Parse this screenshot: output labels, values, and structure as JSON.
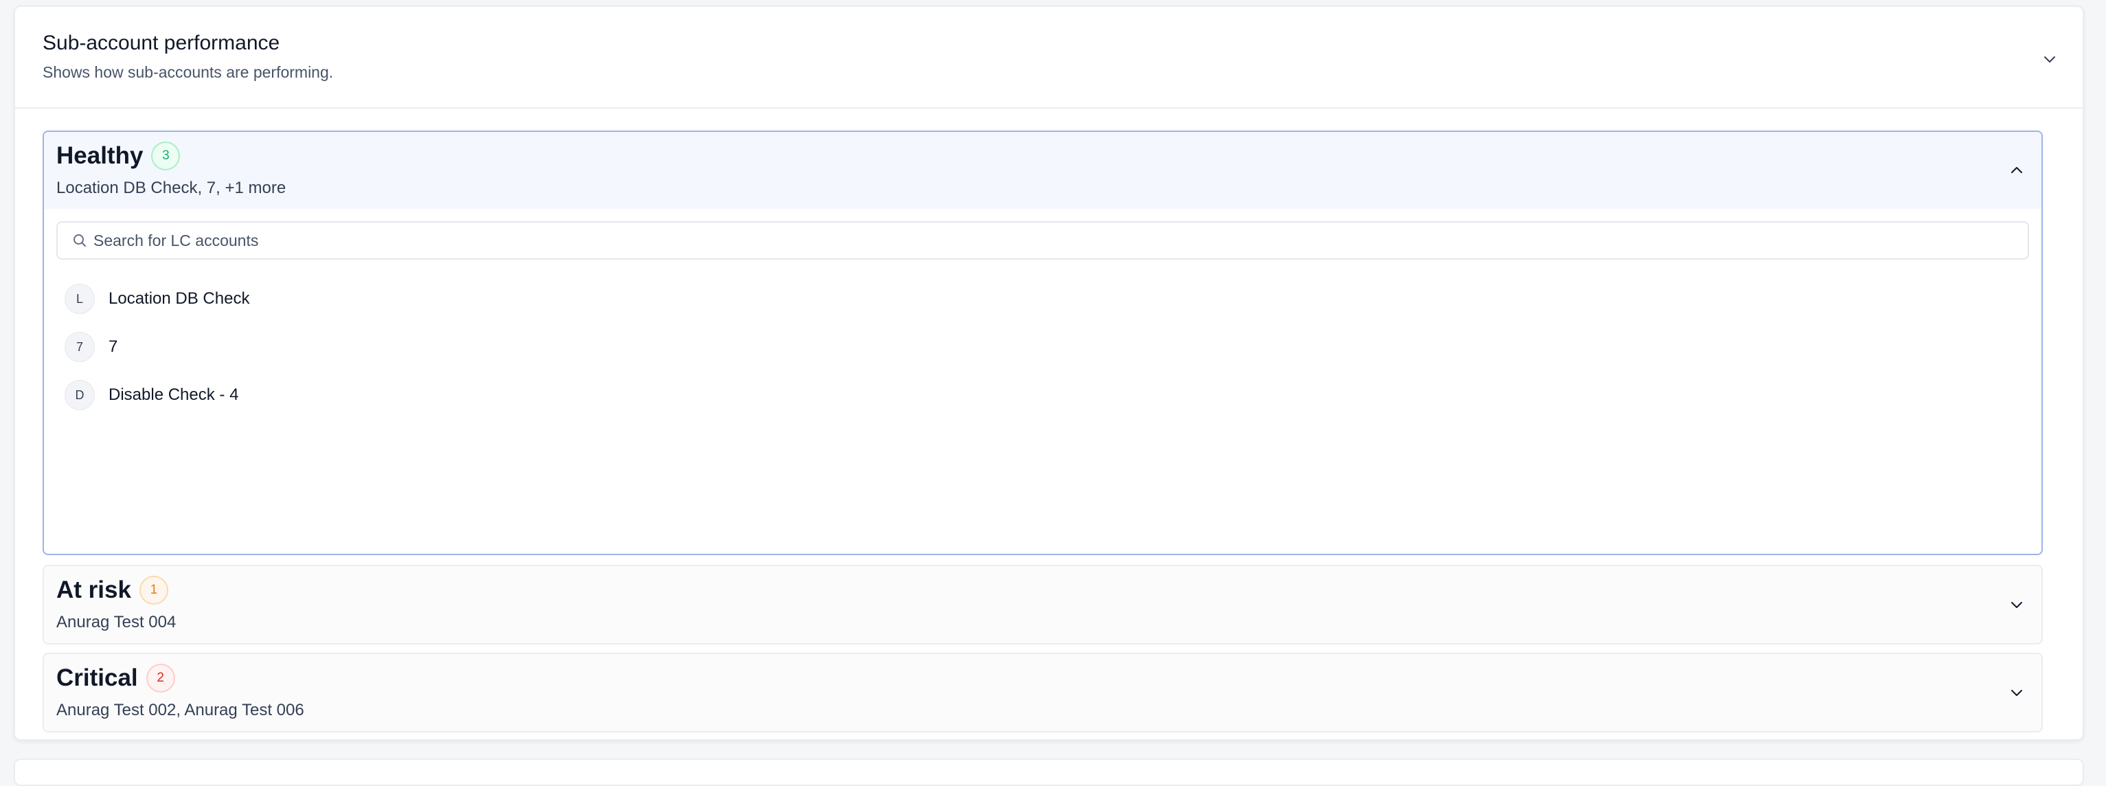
{
  "panel": {
    "title": "Sub-account performance",
    "subtitle": "Shows how sub-accounts are performing."
  },
  "sections": {
    "healthy": {
      "title": "Healthy",
      "count": "3",
      "summary": "Location DB Check, 7, +1 more",
      "expanded": true,
      "badge_color": "#17b26a",
      "search_placeholder": "Search for LC accounts",
      "search_value": "",
      "accounts": [
        {
          "initial": "L",
          "name": "Location DB Check"
        },
        {
          "initial": "7",
          "name": "7"
        },
        {
          "initial": "D",
          "name": "Disable Check - 4"
        }
      ]
    },
    "at_risk": {
      "title": "At risk",
      "count": "1",
      "summary": "Anurag Test 004",
      "expanded": false,
      "badge_color": "#e97a16"
    },
    "critical": {
      "title": "Critical",
      "count": "2",
      "summary": "Anurag Test 002, Anurag Test 006",
      "expanded": false,
      "badge_color": "#d92d20"
    }
  },
  "icons": {
    "panel_toggle": "chevron-down-icon",
    "healthy_toggle": "chevron-up-icon",
    "at_risk_toggle": "chevron-down-icon",
    "critical_toggle": "chevron-down-icon",
    "search": "search-icon"
  },
  "colors": {
    "accent_border": "#9fb3ea",
    "expanded_header_bg": "#f4f7fe"
  }
}
